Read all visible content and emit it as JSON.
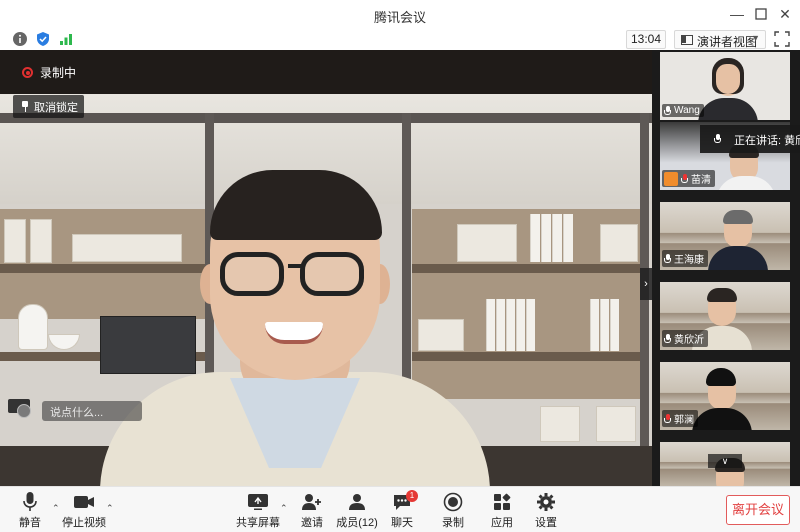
{
  "window": {
    "title": "腾讯会议",
    "controls": [
      "minimize",
      "maximize",
      "close"
    ]
  },
  "status_bar": {
    "icons": [
      "info-icon",
      "shield-icon",
      "signal-icon"
    ],
    "clock": "13:04",
    "view_mode": "演讲者视图"
  },
  "stage": {
    "recording_label": "录制中",
    "unpin_label": "取消锁定",
    "chat_placeholder": "说点什么..."
  },
  "speaking_tip": "正在讲话: 黄欣沂",
  "participants": [
    {
      "name": "Wang"
    },
    {
      "name": "苗清"
    },
    {
      "name": "王海康"
    },
    {
      "name": "黄欣沂"
    },
    {
      "name": "郭澜"
    },
    {
      "name": ""
    }
  ],
  "toolbar": {
    "mute": "静音",
    "stop_video": "停止视频",
    "share_screen": "共享屏幕",
    "invite": "邀请",
    "members": "成员(12)",
    "chat": "聊天",
    "chat_badge": "1",
    "record": "录制",
    "apps": "应用",
    "settings": "设置",
    "leave": "离开会议"
  },
  "colors": {
    "recording_red": "#e03030",
    "leave_red": "#e24040",
    "badge_red": "#e53935",
    "signal_green": "#2db84d",
    "shield_blue": "#2a7de1"
  }
}
